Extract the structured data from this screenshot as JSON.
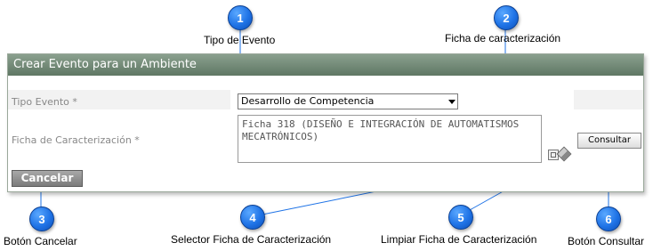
{
  "panel": {
    "title": "Crear Evento para un Ambiente",
    "tipo_evento_label": "Tipo Evento *",
    "tipo_evento_value": "Desarrollo de Competencia",
    "ficha_label": "Ficha de Caracterización *",
    "ficha_value": "Ficha 318 (DISEÑO E INTEGRACIÓN DE AUTOMATISMOS MECATRÓNICOS)",
    "consultar_label": "Consultar",
    "cancelar_label": "Cancelar"
  },
  "annotations": [
    {
      "number": "1",
      "text": "Tipo de Evento"
    },
    {
      "number": "2",
      "text": "Ficha de caracterización"
    },
    {
      "number": "3",
      "text": "Botón Cancelar"
    },
    {
      "number": "4",
      "text": "Selector Ficha de Caracterización"
    },
    {
      "number": "5",
      "text": "Limpiar Ficha de Caracterización"
    },
    {
      "number": "6",
      "text": "Botón Consultar"
    }
  ],
  "colors": {
    "header_top": "#8aa08e",
    "header_bottom": "#5f7764",
    "bubble": "#1f73e6",
    "callout_line": "#1f73e6"
  }
}
